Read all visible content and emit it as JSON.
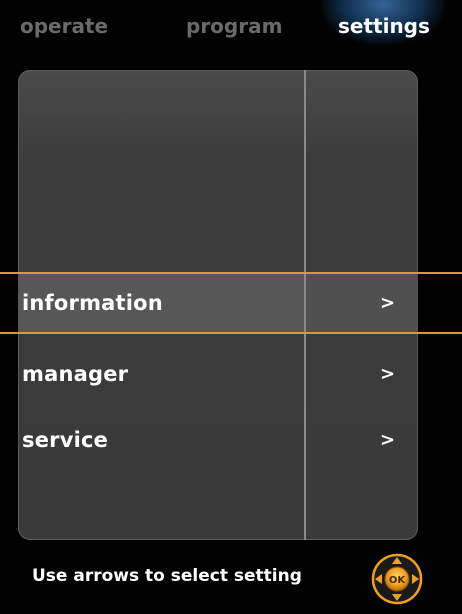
{
  "tabs": {
    "operate": "operate",
    "program": "program",
    "settings": "settings",
    "active": "settings"
  },
  "menu": {
    "items": [
      {
        "label": "information",
        "arrow": ">",
        "selected": true
      },
      {
        "label": "manager",
        "arrow": ">",
        "selected": false
      },
      {
        "label": "service",
        "arrow": ">",
        "selected": false
      }
    ]
  },
  "footer": {
    "hint": "Use arrows to select setting",
    "nav_pad_label": "OK"
  },
  "colors": {
    "background": "#000000",
    "panel": "#3c3c3c",
    "highlight": "#e0982a",
    "active_tab_glow": "#3a6fa8",
    "nav_pad": "#f0a020"
  },
  "icons": {
    "nav_pad": "directional-ok-pad-icon",
    "chevron": "chevron-right-icon"
  }
}
